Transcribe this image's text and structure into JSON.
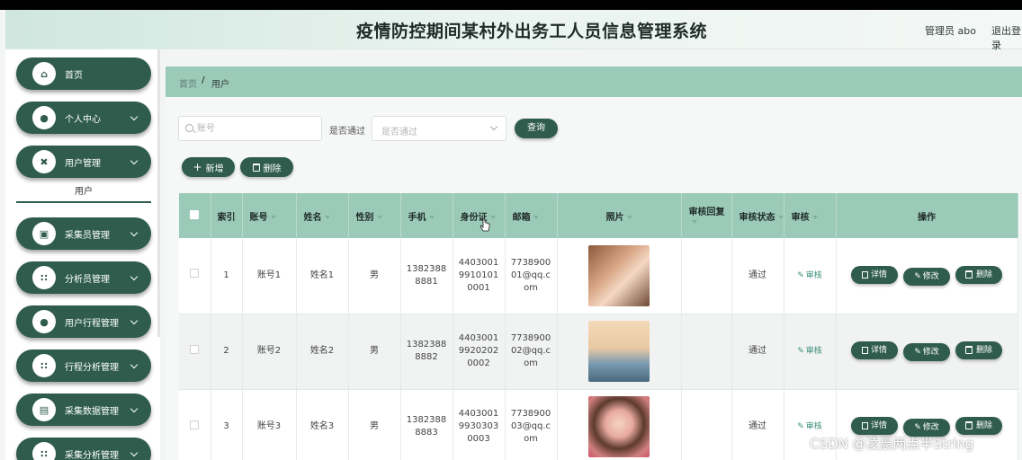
{
  "header": {
    "title": "疫情防控期间某村外出务工人员信息管理系统",
    "user": "管理员 abo",
    "logout": "退出登录"
  },
  "sidebar": {
    "items": [
      {
        "label": "首页",
        "icon": "home-icon"
      },
      {
        "label": "个人中心",
        "icon": "person-icon"
      },
      {
        "label": "用户管理",
        "icon": "user-manage-icon"
      },
      {
        "label": "采集员管理",
        "icon": "collector-icon"
      },
      {
        "label": "分析员管理",
        "icon": "grid-icon"
      },
      {
        "label": "用户行程管理",
        "icon": "person-icon"
      },
      {
        "label": "行程分析管理",
        "icon": "grid-icon"
      },
      {
        "label": "采集数据管理",
        "icon": "clipboard-icon"
      },
      {
        "label": "采集分析管理",
        "icon": "grid-icon"
      }
    ],
    "submenu": {
      "label": "用户"
    }
  },
  "breadcrumb": {
    "home": "首页",
    "separator": "/",
    "current": "用户"
  },
  "search": {
    "account_placeholder": "账号",
    "filter_label": "是否通过",
    "filter_placeholder": "是否通过",
    "query_label": "查询"
  },
  "actions": {
    "add_label": "新增",
    "delete_label": "删除"
  },
  "table": {
    "headers": {
      "index": "索引",
      "account": "账号",
      "name": "姓名",
      "gender": "性别",
      "phone": "手机",
      "idcard": "身份证",
      "email": "邮箱",
      "photo": "照片",
      "reply": "审核回复",
      "status": "审核状态",
      "audit": "审核",
      "ops": "操作"
    },
    "rows": [
      {
        "index": "1",
        "account": "账号1",
        "name": "姓名1",
        "gender": "男",
        "phone": "13823888881",
        "idcard": "440300199101010001",
        "email": "773890001@qq.com",
        "reply": "",
        "status": "通过",
        "audit": "审核"
      },
      {
        "index": "2",
        "account": "账号2",
        "name": "姓名2",
        "gender": "男",
        "phone": "13823888882",
        "idcard": "440300199202020002",
        "email": "773890002@qq.com",
        "reply": "",
        "status": "通过",
        "audit": "审核"
      },
      {
        "index": "3",
        "account": "账号3",
        "name": "姓名3",
        "gender": "男",
        "phone": "13823888883",
        "idcard": "440300199303030003",
        "email": "773890003@qq.com",
        "reply": "",
        "status": "通过",
        "audit": "审核"
      }
    ],
    "op_labels": {
      "detail": "详情",
      "edit": "修改",
      "delete": "删除"
    }
  },
  "watermark": "CSDN @凌晨两点半String",
  "colors": {
    "primary": "#2f5c4d",
    "header_row": "#9ccab9",
    "accent": "#3a8f79"
  }
}
